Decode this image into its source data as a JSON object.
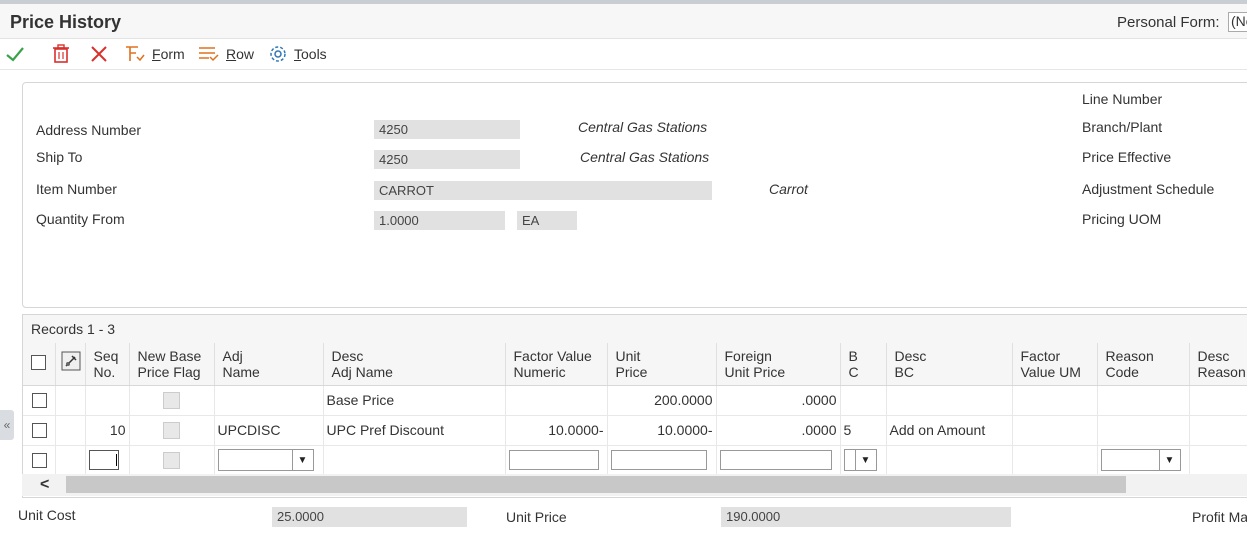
{
  "header": {
    "title": "Price History",
    "personal_form_label": "Personal Form:",
    "personal_form_value": "(No"
  },
  "toolbar": {
    "form": "Form",
    "row": "Row",
    "tools": "Tools",
    "form_key": "F",
    "form_rest": "orm",
    "row_key": "R",
    "row_rest": "ow",
    "tools_key": "T",
    "tools_rest": "ools"
  },
  "form": {
    "address_number_label": "Address Number",
    "address_number": "4250",
    "address_name": "Central Gas Stations",
    "ship_to_label": "Ship To",
    "ship_to": "4250",
    "ship_to_name": "Central Gas Stations",
    "item_number_label": "Item Number",
    "item_number": "CARROT",
    "item_desc": "Carrot",
    "quantity_from_label": "Quantity From",
    "quantity_from": "1.0000",
    "uom": "EA",
    "line_number_label": "Line Number",
    "branch_plant_label": "Branch/Plant",
    "price_effective_label": "Price Effective",
    "adjustment_schedule_label": "Adjustment Schedule",
    "pricing_uom_label": "Pricing UOM"
  },
  "grid": {
    "records": "Records 1 - 3",
    "columns": [
      [
        "Seq",
        "No."
      ],
      [
        "New Base",
        "Price Flag"
      ],
      [
        "Adj",
        "Name"
      ],
      [
        "Desc",
        "Adj Name"
      ],
      [
        "Factor Value",
        "Numeric"
      ],
      [
        "Unit",
        "Price"
      ],
      [
        "Foreign",
        "Unit Price"
      ],
      [
        "B",
        "C"
      ],
      [
        "Desc",
        "BC"
      ],
      [
        "Factor",
        "Value UM"
      ],
      [
        "Reason",
        "Code"
      ],
      [
        "Desc",
        "Reason"
      ]
    ],
    "rows": [
      {
        "seq": "",
        "adj_name": "",
        "desc_adj": "Base Price",
        "factor": "",
        "unit_price": "200.0000",
        "foreign": ".0000",
        "bc": "",
        "desc_bc": ""
      },
      {
        "seq": "10",
        "adj_name": "UPCDISC",
        "desc_adj": "UPC Pref Discount",
        "factor": "10.0000-",
        "unit_price": "10.0000-",
        "foreign": ".0000",
        "bc": "5",
        "desc_bc": "Add on Amount"
      }
    ]
  },
  "footer": {
    "unit_cost_label": "Unit Cost",
    "unit_cost": "25.0000",
    "unit_price_label": "Unit Price",
    "unit_price": "190.0000",
    "profit_margin_label": "Profit Ma"
  },
  "colors": {
    "accent_green": "#3aa34a",
    "delete_red": "#d9302c",
    "toolbar_orange": "#e0701e",
    "tools_blue": "#2f76b6"
  }
}
